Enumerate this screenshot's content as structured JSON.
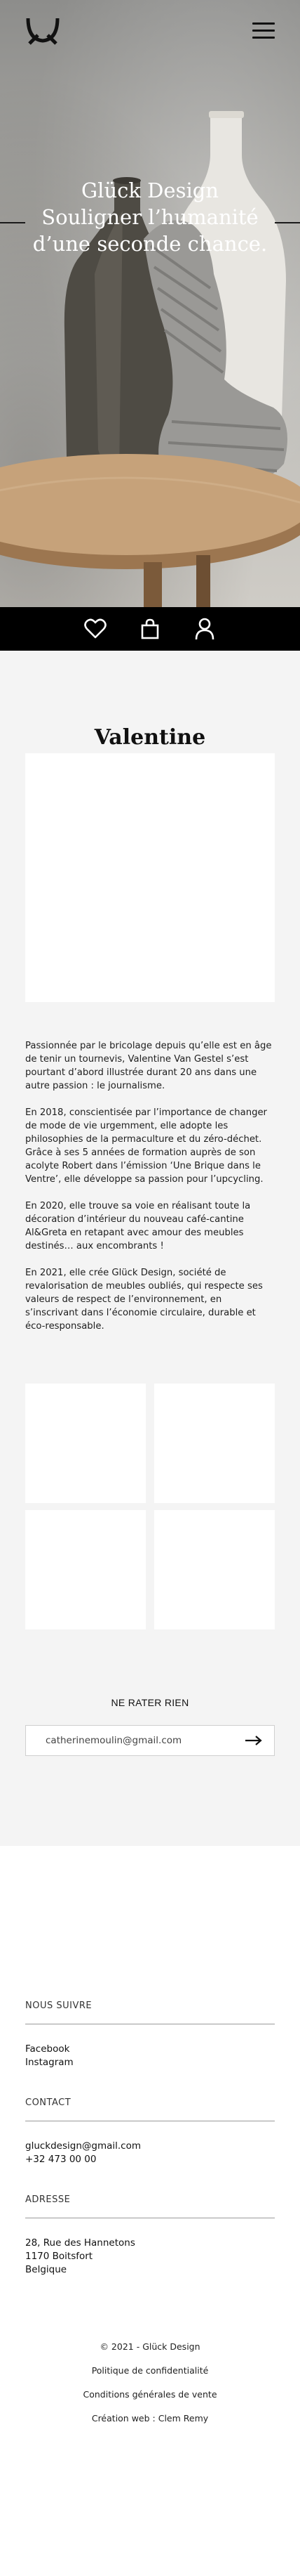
{
  "brand": {
    "name": "Glück Design"
  },
  "hero": {
    "title_line1": "Glück Design",
    "title_line2": "Souligner l’humanité",
    "title_line3": "d’une seconde chance."
  },
  "nav": {
    "menu_icon": "hamburger-menu-icon"
  },
  "iconbar": {
    "icons": [
      "heart-icon",
      "shopping-bag-icon",
      "user-icon"
    ]
  },
  "about": {
    "title": "Valentine",
    "paragraphs": [
      "Passionnée par le bricolage depuis qu’elle est en âge de tenir un tournevis, Valentine Van Gestel s’est pourtant d’abord illustrée durant 20 ans dans une autre passion : le journalisme.",
      "En 2018, conscientisée par l’importance de changer de mode de vie urgemment, elle adopte les philosophies de la permaculture et du zéro-déchet. Grâce à ses 5 années de formation auprès de son acolyte Robert dans l’émission ‘Une Brique dans le Ventre’, elle développe sa passion pour l’upcycling.",
      "En 2020, elle trouve sa voie en réalisant toute la décoration d’intérieur du nouveau café-cantine Al&Greta en retapant avec amour des meubles destinés… aux encombrants !",
      "En 2021, elle crée Glück Design, société de revalorisation de meubles oubliés, qui respecte ses valeurs de respect de l’environnement, en s’inscrivant dans l’économie circulaire, durable et éco-responsable."
    ]
  },
  "newsletter": {
    "title": "NE RATER RIEN",
    "placeholder": "catherinemoulin@gmail.com"
  },
  "footer": {
    "follow_heading": "NOUS SUIVRE",
    "facebook": "Facebook",
    "instagram": "Instagram",
    "contact_heading": "CONTACT",
    "email": "gluckdesign@gmail.com",
    "phone": "+32 473 00 00",
    "address_heading": "ADRESSE",
    "address_line1": "28, Rue des Hannetons",
    "address_line2": "1170 Boitsfort",
    "address_line3": "Belgique",
    "copyright": "© 2021 - Glück Design",
    "privacy": "Politique de confidentialité",
    "terms": "Conditions générales de vente",
    "credit": "Création web : Clem Remy"
  }
}
